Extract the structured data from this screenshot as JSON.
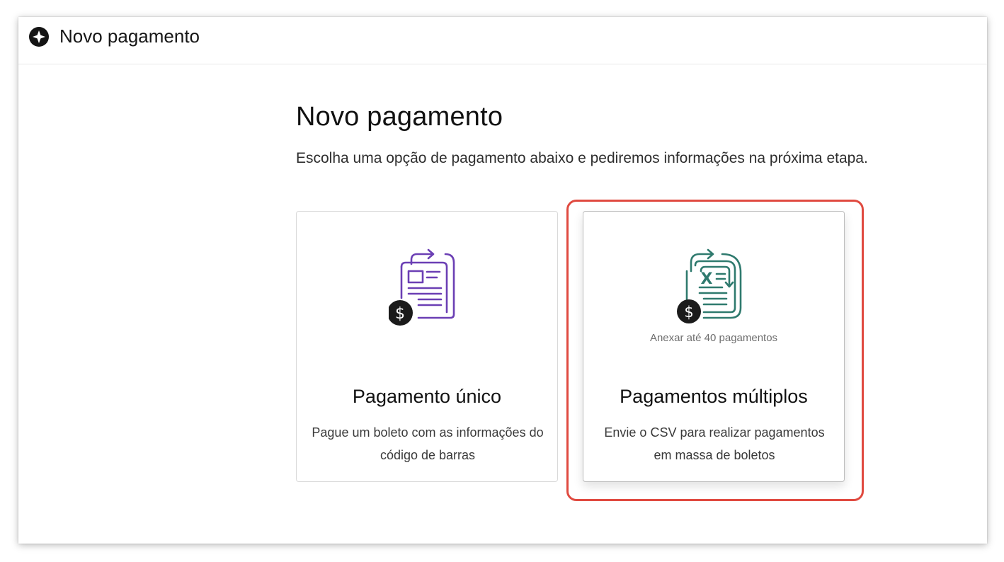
{
  "app": {
    "window_title": "Novo pagamento",
    "header_icon": "compass-star-icon"
  },
  "main": {
    "title": "Novo pagamento",
    "subtitle": "Escolha uma opção de pagamento abaixo e pediremos informações na próxima etapa."
  },
  "options": [
    {
      "icon": "document-payment-icon",
      "icon_color": "#6b3fb4",
      "note": "",
      "title": "Pagamento único",
      "description": "Pague um boleto com as informações do código de barras"
    },
    {
      "icon": "spreadsheet-payment-icon",
      "icon_color": "#2f7a6e",
      "note": "Anexar até 40 pagamentos",
      "title": "Pagamentos múltiplos",
      "description": "Envie o CSV para realizar pagamentos em massa de boletos",
      "highlighted": true
    }
  ],
  "colors": {
    "highlight": "#e04a40",
    "badge": "#1b1b1b"
  }
}
